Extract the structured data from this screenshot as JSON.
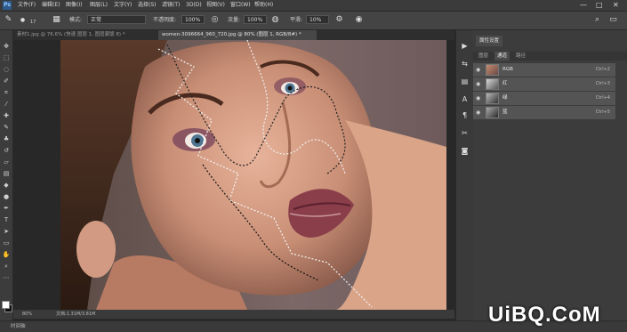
{
  "menu": {
    "app_icon": "Ps",
    "items": [
      "文件(F)",
      "编辑(E)",
      "图像(I)",
      "图层(L)",
      "文字(Y)",
      "选择(S)",
      "滤镜(T)",
      "3D(D)",
      "视图(V)",
      "窗口(W)",
      "帮助(H)"
    ],
    "window_controls": [
      "—",
      "□",
      "✕"
    ]
  },
  "options": {
    "brush_size": "17",
    "mode_label": "模式:",
    "mode_value": "正常",
    "opacity_label": "不透明度:",
    "opacity_value": "100%",
    "flow_label": "流量:",
    "flow_value": "100%",
    "smooth_label": "平滑:",
    "smooth_value": "10%"
  },
  "tabs": [
    {
      "label": "素材1.jpg @ 76.6% (快速 图层 1, 图层蒙版 8) *",
      "active": false
    },
    {
      "label": "women-3096664_960_720.jpg @ 80% (图层 1, RGB/8#) *",
      "active": true
    }
  ],
  "status": {
    "zoom": "80%",
    "doc_info": "文档:1.31M/3.81M"
  },
  "timeline": {
    "label": "时间轴"
  },
  "panel": {
    "title": "属性设置",
    "tabs": [
      "图层",
      "通道",
      "路径"
    ],
    "active_tab": 1,
    "channels": [
      {
        "name": "RGB",
        "shortcut": "Ctrl+2"
      },
      {
        "name": "红",
        "shortcut": "Ctrl+3"
      },
      {
        "name": "绿",
        "shortcut": "Ctrl+4"
      },
      {
        "name": "蓝",
        "shortcut": "Ctrl+5"
      }
    ]
  },
  "watermark": "UiBQ.CoM",
  "colors": {
    "accent": "#2d5a8a",
    "panel_bg": "#3c3c3c",
    "canvas_bg": "#282828"
  }
}
